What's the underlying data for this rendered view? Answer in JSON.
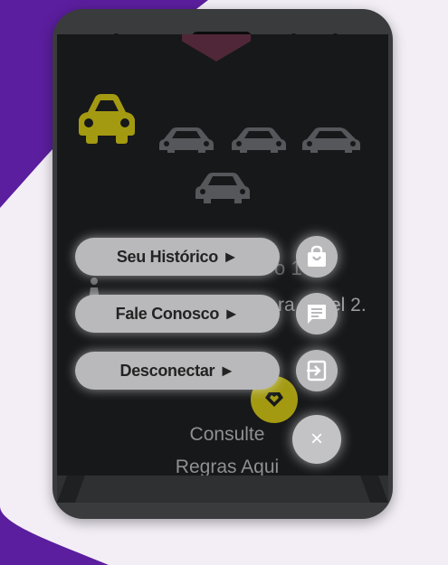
{
  "colors": {
    "background": "#5b1e9e",
    "blob": "#f3eef6",
    "screen": "#17181a",
    "accent_yellow": "#a39a12",
    "button": "#b9b9bb"
  },
  "levels": {
    "active_car_icon": "car-icon",
    "inactive_car_count": 4
  },
  "background_text": {
    "level_fragment": "o 1",
    "line_fragment": "ra",
    "level_fragment_2": "el 2."
  },
  "menu": {
    "items": [
      {
        "label": "Seu Histórico ►",
        "icon": "shopping-bag-icon"
      },
      {
        "label": "Fale Conosco ►",
        "icon": "chat-icon"
      },
      {
        "label": "Desconectar ►",
        "icon": "logout-icon"
      }
    ],
    "close_label": "×"
  },
  "rules": {
    "line1": "Consulte",
    "line2": "Regras Aqui"
  }
}
